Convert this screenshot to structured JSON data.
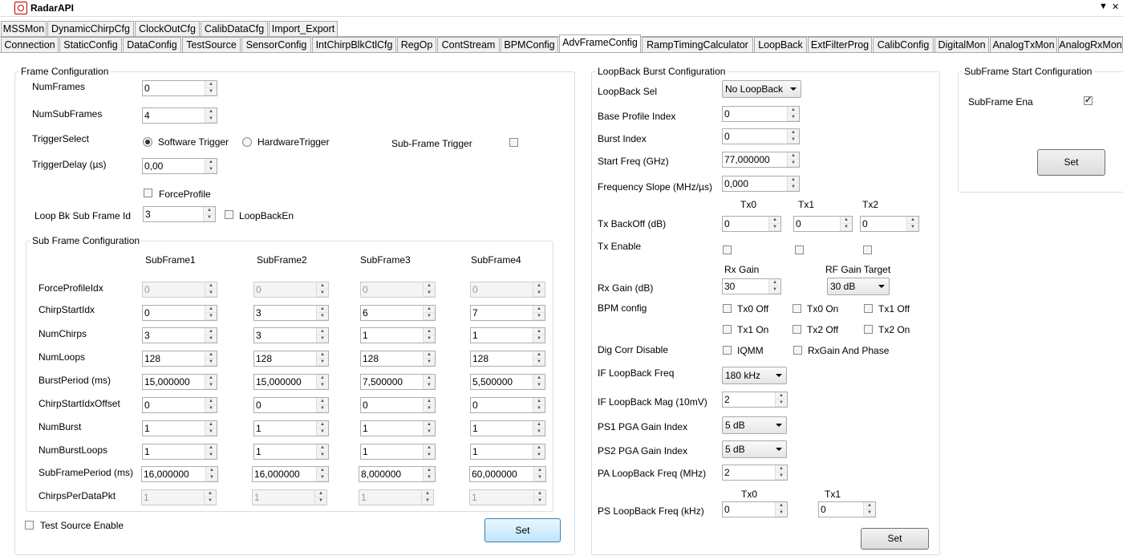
{
  "app": {
    "title": "RadarAPI"
  },
  "tabs_row1": [
    "MSSMon",
    "DynamicChirpCfg",
    "ClockOutCfg",
    "CalibDataCfg",
    "Import_Export"
  ],
  "tabs_row2": [
    "Connection",
    "StaticConfig",
    "DataConfig",
    "TestSource",
    "SensorConfig",
    "IntChirpBlkCtlCfg",
    "RegOp",
    "ContStream",
    "BPMConfig",
    "AdvFrameConfig",
    "RampTimingCalculator",
    "LoopBack",
    "ExtFilterProg",
    "CalibConfig",
    "DigitalMon",
    "AnalogTxMon",
    "AnalogRxMon"
  ],
  "active_tab": "AdvFrameConfig",
  "frame": {
    "legend": "Frame Configuration",
    "num_frames_label": "NumFrames",
    "num_frames": "0",
    "num_subframes_label": "NumSubFrames",
    "num_subframes": "4",
    "trigger_select_label": "TriggerSelect",
    "software_trigger": "Software Trigger",
    "hardware_trigger": "HardwareTrigger",
    "subframe_trigger": "Sub-Frame Trigger",
    "trigger_delay_label": "TriggerDelay (µs)",
    "trigger_delay": "0,00",
    "force_profile": "ForceProfile",
    "loop_bk_label": "Loop Bk Sub Frame Id",
    "loop_bk": "3",
    "loopback_en": "LoopBackEn",
    "test_source_enable": "Test Source Enable",
    "set": "Set"
  },
  "subframe": {
    "legend": "Sub Frame Configuration",
    "headers": [
      "SubFrame1",
      "SubFrame2",
      "SubFrame3",
      "SubFrame4"
    ],
    "rows": [
      {
        "label": "ForceProfileIdx",
        "values": [
          "0",
          "0",
          "0",
          "0"
        ],
        "disabled": true
      },
      {
        "label": "ChirpStartIdx",
        "values": [
          "0",
          "3",
          "6",
          "7"
        ]
      },
      {
        "label": "NumChirps",
        "values": [
          "3",
          "3",
          "1",
          "1"
        ]
      },
      {
        "label": "NumLoops",
        "values": [
          "128",
          "128",
          "128",
          "128"
        ]
      },
      {
        "label": "BurstPeriod (ms)",
        "values": [
          "15,000000",
          "15,000000",
          "7,500000",
          "5,500000"
        ]
      },
      {
        "label": "ChirpStartIdxOffset",
        "values": [
          "0",
          "0",
          "0",
          "0"
        ]
      },
      {
        "label": "NumBurst",
        "values": [
          "1",
          "1",
          "1",
          "1"
        ]
      },
      {
        "label": "NumBurstLoops",
        "values": [
          "1",
          "1",
          "1",
          "1"
        ]
      },
      {
        "label": "SubFramePeriod (ms)",
        "values": [
          "16,000000",
          "16,000000",
          "8,000000",
          "60,000000"
        ]
      },
      {
        "label": "ChirpsPerDataPkt",
        "values": [
          "1",
          "1",
          "1",
          "1"
        ],
        "disabled": true
      }
    ]
  },
  "loopback": {
    "legend": "LoopBack Burst Configuration",
    "sel_label": "LoopBack Sel",
    "sel": "No LoopBack",
    "base_profile_label": "Base Profile Index",
    "base_profile": "0",
    "burst_index_label": "Burst Index",
    "burst_index": "0",
    "start_freq_label": "Start Freq (GHz)",
    "start_freq": "77,000000",
    "freq_slope_label": "Frequency Slope (MHz/µs)",
    "freq_slope": "0,000",
    "tx_headers": [
      "Tx0",
      "Tx1",
      "Tx2"
    ],
    "tx_backoff_label": "Tx BackOff (dB)",
    "tx_backoff": [
      "0",
      "0",
      "0"
    ],
    "tx_enable_label": "Tx Enable",
    "rx_gain_header": "Rx Gain",
    "rf_gain_header": "RF Gain Target",
    "rx_gain_label": "Rx Gain (dB)",
    "rx_gain": "30",
    "rf_gain": "30 dB",
    "bpm_label": "BPM config",
    "bpm_opts": [
      "Tx0 Off",
      "Tx0 On",
      "Tx1 Off",
      "Tx1 On",
      "Tx2 Off",
      "Tx2 On"
    ],
    "dig_corr_label": "Dig Corr Disable",
    "iqmm": "IQMM",
    "rxgain_phase": "RxGain And Phase",
    "if_freq_label": "IF LoopBack Freq",
    "if_freq": "180 kHz",
    "if_mag_label": "IF LoopBack Mag (10mV)",
    "if_mag": "2",
    "ps1_label": "PS1 PGA Gain Index",
    "ps1": "5 dB",
    "ps2_label": "PS2 PGA Gain Index",
    "ps2": "5 dB",
    "pa_freq_label": "PA LoopBack Freq (MHz)",
    "pa_freq": "2",
    "ps_headers": [
      "Tx0",
      "Tx1"
    ],
    "ps_freq_label": "PS LoopBack Freq (kHz)",
    "ps_freq": [
      "0",
      "0"
    ],
    "set": "Set"
  },
  "subframe_start": {
    "legend": "SubFrame Start Configuration",
    "ena_label": "SubFrame Ena",
    "set": "Set"
  }
}
